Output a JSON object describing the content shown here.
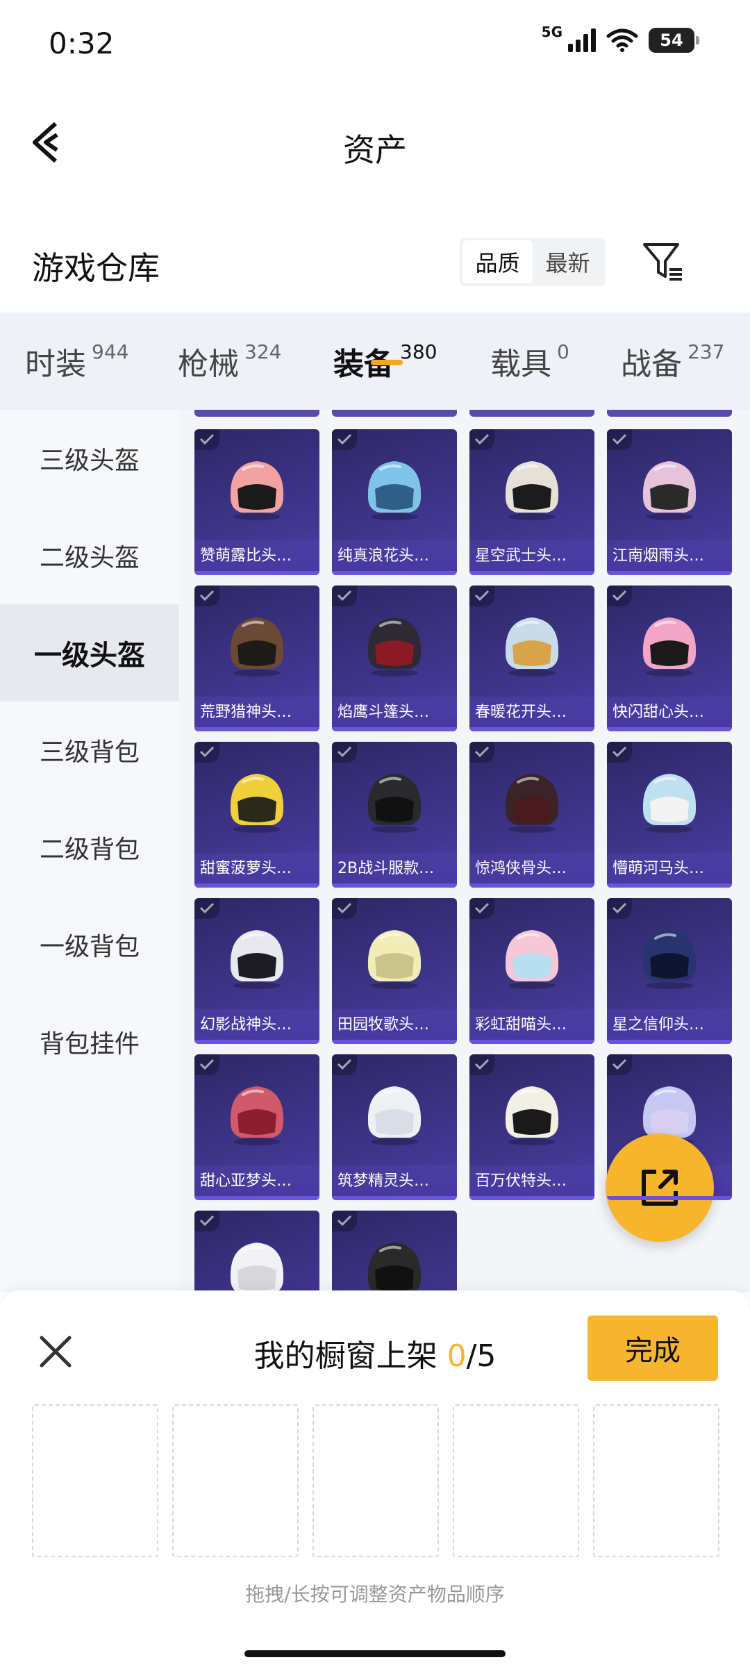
{
  "status_bar": {
    "time": "0:32",
    "network": "5G",
    "battery": "54"
  },
  "header": {
    "title": "资产"
  },
  "section": {
    "title": "游戏仓库",
    "sort_options": [
      "品质",
      "最新"
    ],
    "active_sort": "品质"
  },
  "categories": [
    {
      "label": "时装",
      "count": "944"
    },
    {
      "label": "枪械",
      "count": "324"
    },
    {
      "label": "装备",
      "count": "380",
      "active": true
    },
    {
      "label": "载具",
      "count": "0"
    },
    {
      "label": "战备",
      "count": "237"
    }
  ],
  "sidebar": {
    "items": [
      {
        "label": "三级头盔"
      },
      {
        "label": "二级头盔"
      },
      {
        "label": "一级头盔",
        "active": true
      },
      {
        "label": "三级背包"
      },
      {
        "label": "二级背包"
      },
      {
        "label": "一级背包"
      },
      {
        "label": "背包挂件"
      }
    ]
  },
  "items": [
    {
      "name": "赞萌露比头…",
      "color": "#f2a2a0",
      "visor": "#1a1a1a"
    },
    {
      "name": "纯真浪花头…",
      "color": "#7fc4e8",
      "visor": "#2e5f86"
    },
    {
      "name": "星空武士头…",
      "color": "#e6e1d6",
      "visor": "#1c1c1c"
    },
    {
      "name": "江南烟雨头…",
      "color": "#e7c3da",
      "visor": "#2a2a2a"
    },
    {
      "name": "荒野猎神头…",
      "color": "#6a4a36",
      "visor": "#1e1a18"
    },
    {
      "name": "焰鹰斗篷头…",
      "color": "#2d2a33",
      "visor": "#8a1a24"
    },
    {
      "name": "春暖花开头…",
      "color": "#c9dbe8",
      "visor": "#d8a44a"
    },
    {
      "name": "快闪甜心头…",
      "color": "#f0a6c4",
      "visor": "#1a1a1a"
    },
    {
      "name": "甜蜜菠萝头…",
      "color": "#f0d03a",
      "visor": "#2a2a1a"
    },
    {
      "name": "2B战斗服款…",
      "color": "#2a2a2e",
      "visor": "#111111"
    },
    {
      "name": "惊鸿侠骨头…",
      "color": "#3a2428",
      "visor": "#4a1a1e"
    },
    {
      "name": "懵萌河马头…",
      "color": "#bfe0f0",
      "visor": "#f3f3f3"
    },
    {
      "name": "幻影战神头…",
      "color": "#e8e8ee",
      "visor": "#1c1c22"
    },
    {
      "name": "田园牧歌头…",
      "color": "#f1ecb8",
      "visor": "#c8c48a"
    },
    {
      "name": "彩虹甜喵头…",
      "color": "#f6c7d7",
      "visor": "#b8dff0"
    },
    {
      "name": "星之信仰头…",
      "color": "#27346e",
      "visor": "#0f1430"
    },
    {
      "name": "甜心亚梦头…",
      "color": "#d05a6c",
      "visor": "#8c1e30"
    },
    {
      "name": "筑梦精灵头…",
      "color": "#eef0f4",
      "visor": "#d8dde6"
    },
    {
      "name": "百万伏特头…",
      "color": "#f2efe4",
      "visor": "#1a1a1a"
    },
    {
      "name": "",
      "color": "#c5c8f0",
      "visor": "#d8d0f0"
    },
    {
      "name": "",
      "color": "#f2f2f4",
      "visor": "#d8d8dc"
    },
    {
      "name": "",
      "color": "#2a2a2a",
      "visor": "#111111"
    }
  ],
  "sheet": {
    "title": "我的橱窗上架",
    "selected_count": "0",
    "total": "/5",
    "done_label": "完成",
    "hint": "拖拽/长按可调整资产物品顺序",
    "slot_count": 5
  },
  "colors": {
    "accent": "#f5b530",
    "card_bg": "#3d3488"
  }
}
